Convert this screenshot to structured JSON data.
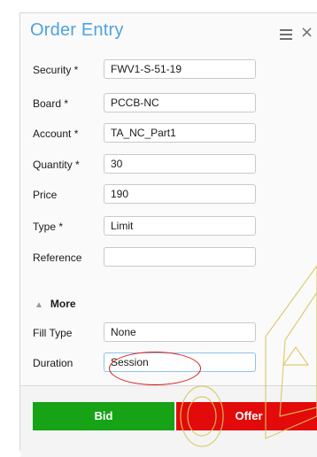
{
  "panel": {
    "title": "Order Entry",
    "menu_icon": "hamburger-menu-icon",
    "close_icon": "close-icon",
    "close_glyph": "×"
  },
  "fields": [
    {
      "label": "Security *",
      "value": "FWV1-S-51-19"
    },
    {
      "label": "Board *",
      "value": "PCCB-NC"
    },
    {
      "label": "Account *",
      "value": "TA_NC_Part1"
    },
    {
      "label": "Quantity *",
      "value": "30"
    },
    {
      "label": "Price",
      "value": "190"
    },
    {
      "label": "Type *",
      "value": "Limit"
    },
    {
      "label": "Reference",
      "value": ""
    }
  ],
  "more": {
    "caret": "▲",
    "label": "More"
  },
  "more_fields": [
    {
      "label": "Fill Type",
      "value": "None"
    },
    {
      "label": "Duration",
      "value": "Session"
    }
  ],
  "buttons": {
    "bid": "Bid",
    "offer": "Offer"
  },
  "colors": {
    "title": "#4fa3de",
    "bid": "#16a316",
    "offer": "#e20a0a",
    "annotation": "#d21818"
  }
}
